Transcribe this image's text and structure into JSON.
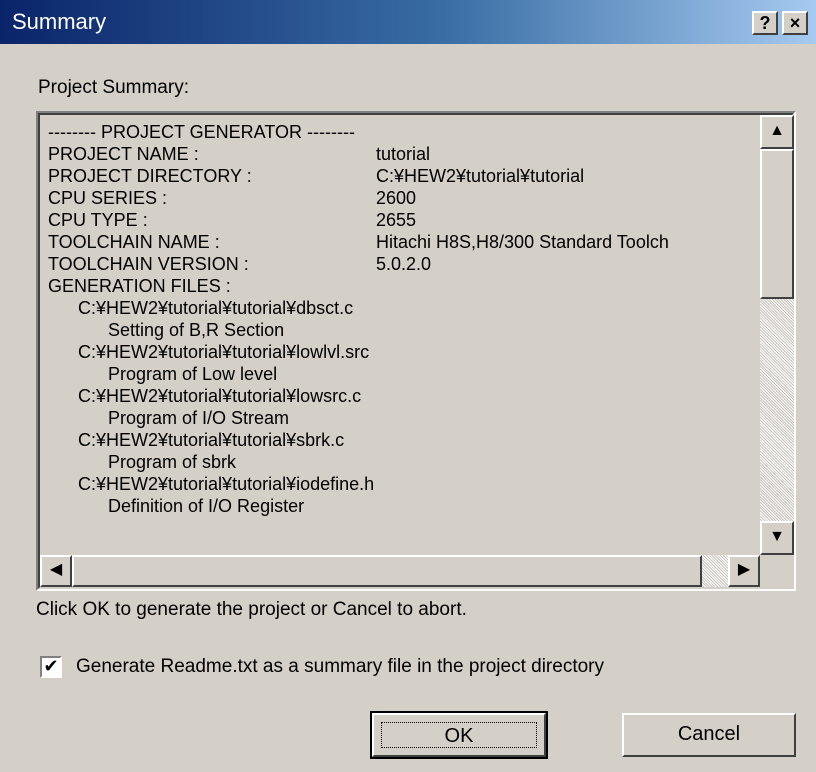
{
  "window": {
    "title": "Summary",
    "help_glyph": "?",
    "close_glyph": "×"
  },
  "heading": "Project Summary:",
  "summary": {
    "header_line": "-------- PROJECT GENERATOR --------",
    "rows": [
      {
        "key": "PROJECT NAME :",
        "value": "tutorial"
      },
      {
        "key": "PROJECT DIRECTORY :",
        "value": "C:¥HEW2¥tutorial¥tutorial"
      },
      {
        "key": "CPU SERIES :",
        "value": "2600"
      },
      {
        "key": "CPU TYPE :",
        "value": "2655"
      },
      {
        "key": "TOOLCHAIN NAME :",
        "value": "Hitachi H8S,H8/300 Standard Toolch"
      },
      {
        "key": "TOOLCHAIN VERSION :",
        "value": "5.0.2.0"
      }
    ],
    "files_label": "GENERATION FILES :",
    "files": [
      {
        "path": "C:¥HEW2¥tutorial¥tutorial¥dbsct.c",
        "desc": "Setting of B,R Section"
      },
      {
        "path": "C:¥HEW2¥tutorial¥tutorial¥lowlvl.src",
        "desc": "Program of Low level"
      },
      {
        "path": "C:¥HEW2¥tutorial¥tutorial¥lowsrc.c",
        "desc": "Program of I/O Stream"
      },
      {
        "path": "C:¥HEW2¥tutorial¥tutorial¥sbrk.c",
        "desc": "Program of sbrk"
      },
      {
        "path": "C:¥HEW2¥tutorial¥tutorial¥iodefine.h",
        "desc": "Definition of I/O Register"
      }
    ]
  },
  "scrollbar": {
    "up_glyph": "▲",
    "down_glyph": "▼",
    "left_glyph": "◀",
    "right_glyph": "▶"
  },
  "instruction": "Click OK to generate the project or Cancel to abort.",
  "readme_option": {
    "checked": true,
    "check_glyph": "✔",
    "label": "Generate Readme.txt as a summary file in the project directory"
  },
  "buttons": {
    "ok_label": "OK",
    "cancel_label": "Cancel"
  }
}
